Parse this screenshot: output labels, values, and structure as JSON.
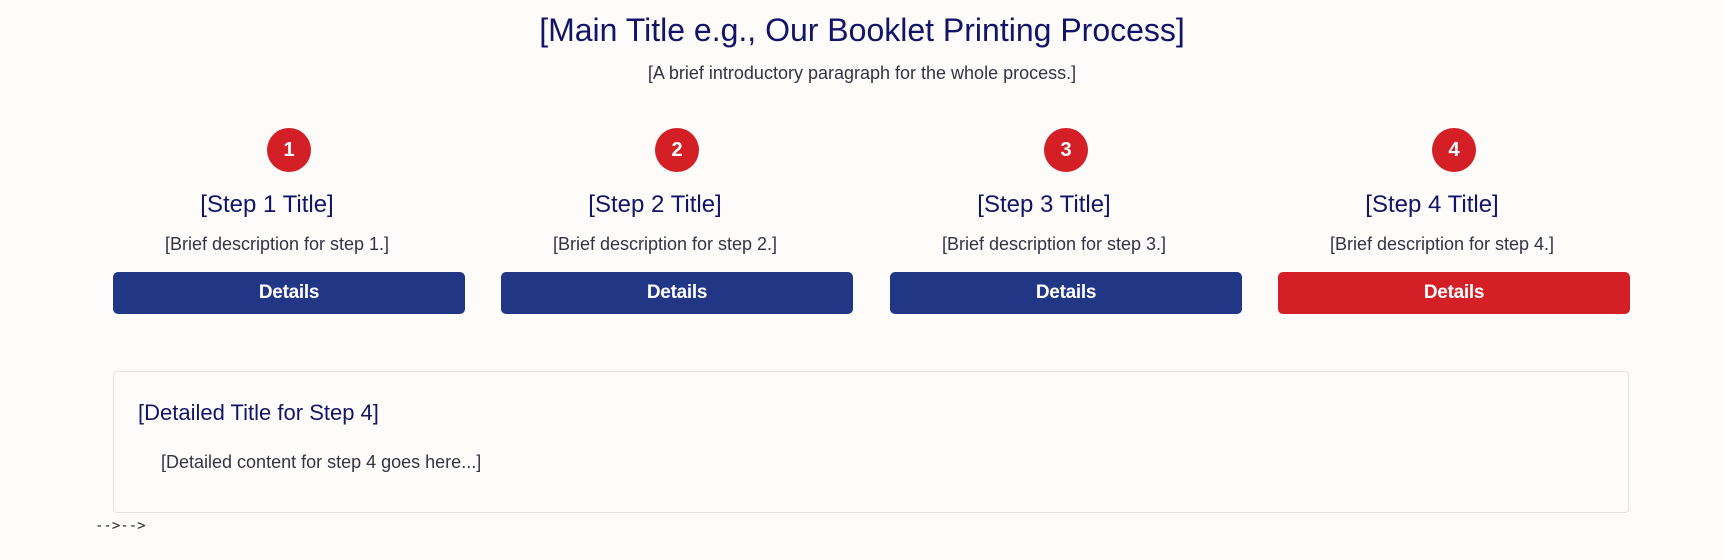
{
  "header": {
    "title": "[Main Title e.g., Our Booklet Printing Process]",
    "intro": "[A brief introductory paragraph for the whole process.]"
  },
  "steps": [
    {
      "number": "1",
      "title": "[Step 1 Title]",
      "description": "[Brief description for step 1.]",
      "button_label": "Details",
      "active": false
    },
    {
      "number": "2",
      "title": "[Step 2 Title]",
      "description": "[Brief description for step 2.]",
      "button_label": "Details",
      "active": false
    },
    {
      "number": "3",
      "title": "[Step 3 Title]",
      "description": "[Brief description for step 3.]",
      "button_label": "Details",
      "active": false
    },
    {
      "number": "4",
      "title": "[Step 4 Title]",
      "description": "[Brief description for step 4.]",
      "button_label": "Details",
      "active": true
    }
  ],
  "detail_panel": {
    "title": "[Detailed Title for Step 4]",
    "content": "[Detailed content for step 4 goes here...]"
  },
  "stray_text": "-->-->",
  "colors": {
    "title": "#10156b",
    "badge": "#d41f27",
    "button": "#213786",
    "button_active": "#d41f27",
    "background": "#fdfcfb"
  }
}
